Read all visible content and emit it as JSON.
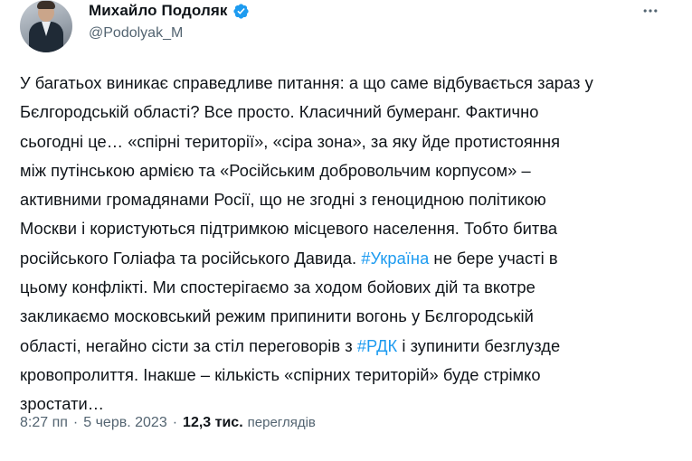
{
  "author": {
    "display_name": "Михайло Подоляк",
    "handle": "@Podolyak_M",
    "verified": true,
    "avatar_icon": "profile-photo-man-suit"
  },
  "menu": {
    "more_icon": "more-horizontal-icon"
  },
  "post": {
    "lines": [
      [
        {
          "text": "У багатьох виникає справедливе питання: а що саме відбувається зараз у"
        }
      ],
      [
        {
          "text": "Бєлгородській області? Все просто. Класичний бумеранг. Фактично"
        }
      ],
      [
        {
          "text": "сьогодні це… «спірні території», «сіра зона», за яку йде протистояння"
        }
      ],
      [
        {
          "text": "між путінською армією та «Російським добровольчим корпусом» –"
        }
      ],
      [
        {
          "text": "активними громадянами Росії, що не згодні з геноцидною політикою"
        }
      ],
      [
        {
          "text": "Москви і користуються підтримкою місцевого населення. Тобто битва"
        }
      ],
      [
        {
          "text": "російського Голіафа та російського Давида. "
        },
        {
          "text": "#Україна",
          "hashtag": true
        },
        {
          "text": " не бере участі в"
        }
      ],
      [
        {
          "text": "цьому конфлікті. Ми спостерігаємо за ходом бойових дій та вкотре"
        }
      ],
      [
        {
          "text": "закликаємо московський режим припинити вогонь у Бєлгородській"
        }
      ],
      [
        {
          "text": "області, негайно сісти за стіл переговорів з "
        },
        {
          "text": "#РДК",
          "hashtag": true
        },
        {
          "text": " і зупинити безглузде"
        }
      ],
      [
        {
          "text": "кровопролиття. Інакше – кількість «спірних територій» буде стрімко"
        }
      ],
      [
        {
          "text": "зростати…"
        }
      ]
    ]
  },
  "meta": {
    "time": "8:27 пп",
    "separator": "·",
    "date": "5 черв. 2023",
    "views_count": "12,3 тис.",
    "views_label": "переглядів"
  },
  "colors": {
    "link": "#1d9bf0",
    "verified": "#1d9bf0",
    "secondary_text": "#536471",
    "primary_text": "#0f1419"
  }
}
